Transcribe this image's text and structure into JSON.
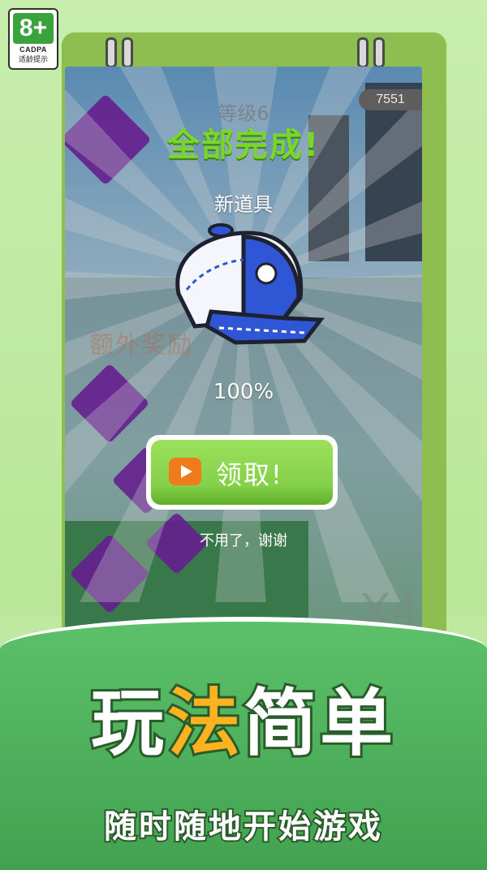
{
  "age_rating": {
    "age": "8+",
    "org": "CADPA",
    "tip": "适龄提示"
  },
  "game": {
    "coins": "7551",
    "level": "等级6",
    "complete_title": "全部完成!",
    "new_item_label": "新道具",
    "item_icon": "blue-white-cap-icon",
    "faded_bonus_text": "额外奖励",
    "progress_percent": "100%",
    "claim_button_label": "领取!",
    "decline_label": "不用了，谢谢",
    "multiplier": "X4"
  },
  "banner": {
    "headline_part1": "玩",
    "headline_part2": "法",
    "headline_part3": "简单",
    "subtitle": "随时随地开始游戏"
  },
  "colors": {
    "accent_green": "#85d149",
    "complete_green": "#7bd62b",
    "play_orange": "#f07b1a",
    "headline_orange": "#ffb21f"
  }
}
